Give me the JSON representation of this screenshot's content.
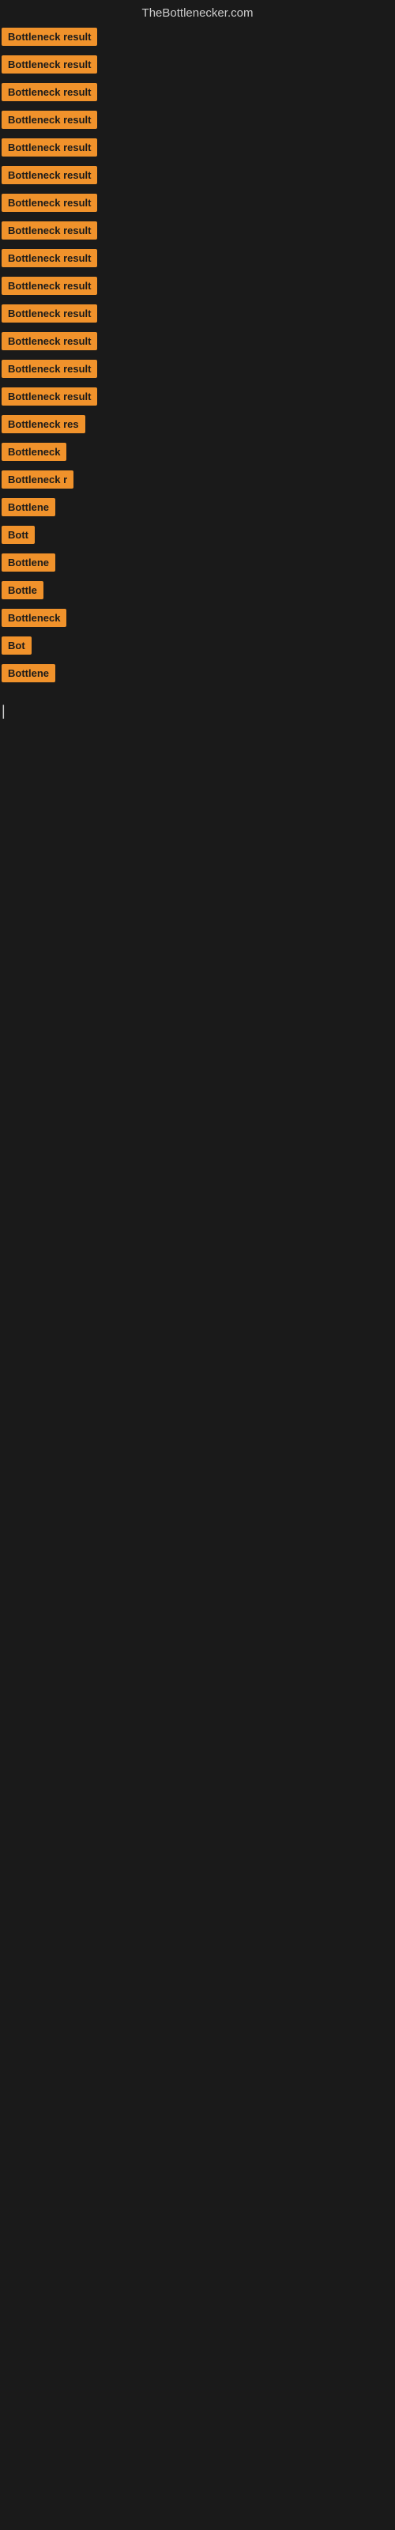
{
  "header": {
    "title": "TheBottlenecker.com"
  },
  "items": [
    {
      "id": 1,
      "label": "Bottleneck result",
      "width": "full"
    },
    {
      "id": 2,
      "label": "Bottleneck result",
      "width": "full"
    },
    {
      "id": 3,
      "label": "Bottleneck result",
      "width": "full"
    },
    {
      "id": 4,
      "label": "Bottleneck result",
      "width": "full"
    },
    {
      "id": 5,
      "label": "Bottleneck result",
      "width": "full"
    },
    {
      "id": 6,
      "label": "Bottleneck result",
      "width": "full"
    },
    {
      "id": 7,
      "label": "Bottleneck result",
      "width": "full"
    },
    {
      "id": 8,
      "label": "Bottleneck result",
      "width": "full"
    },
    {
      "id": 9,
      "label": "Bottleneck result",
      "width": "full"
    },
    {
      "id": 10,
      "label": "Bottleneck result",
      "width": "full"
    },
    {
      "id": 11,
      "label": "Bottleneck result",
      "width": "full"
    },
    {
      "id": 12,
      "label": "Bottleneck result",
      "width": "full"
    },
    {
      "id": 13,
      "label": "Bottleneck result",
      "width": "full"
    },
    {
      "id": 14,
      "label": "Bottleneck result",
      "width": "full"
    },
    {
      "id": 15,
      "label": "Bottleneck res",
      "width": "partial1"
    },
    {
      "id": 16,
      "label": "Bottleneck",
      "width": "partial2"
    },
    {
      "id": 17,
      "label": "Bottleneck r",
      "width": "partial3"
    },
    {
      "id": 18,
      "label": "Bottlene",
      "width": "partial4"
    },
    {
      "id": 19,
      "label": "Bott",
      "width": "partial5"
    },
    {
      "id": 20,
      "label": "Bottlene",
      "width": "partial4"
    },
    {
      "id": 21,
      "label": "Bottle",
      "width": "partial6"
    },
    {
      "id": 22,
      "label": "Bottleneck",
      "width": "partial2"
    },
    {
      "id": 23,
      "label": "Bot",
      "width": "partial7"
    },
    {
      "id": 24,
      "label": "Bottlene",
      "width": "partial4"
    }
  ]
}
